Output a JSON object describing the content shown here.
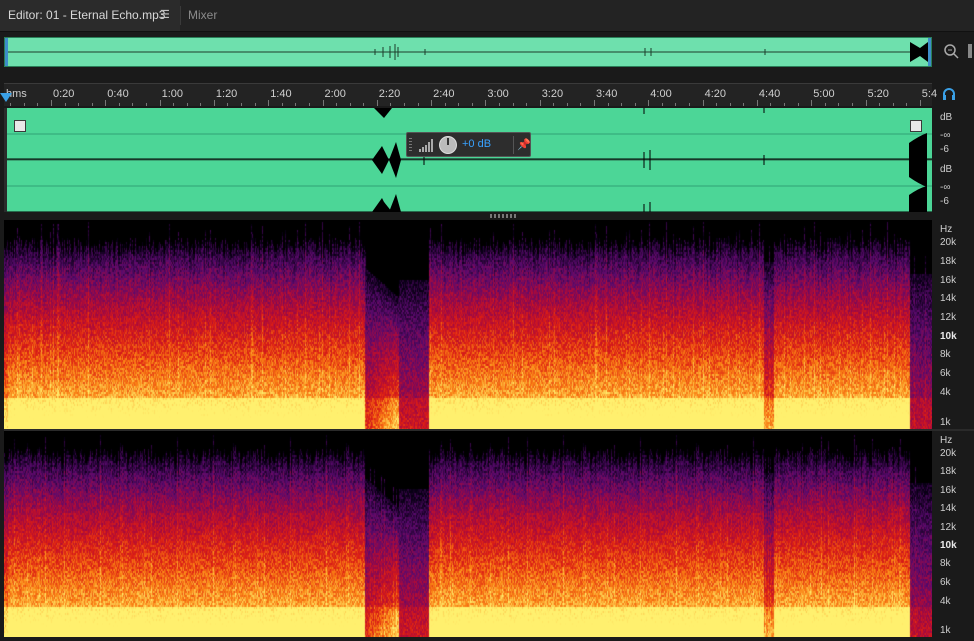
{
  "tabs": {
    "editor_label": "Editor: 01 - Eternal Echo.mp3",
    "menu_glyph": "☰",
    "mixer_label": "Mixer"
  },
  "icons": {
    "zoom": "zoom-icon",
    "headphones": "headphones-icon",
    "pin": "pin-icon"
  },
  "ruler": {
    "unit": "hms",
    "labels": [
      "0:20",
      "0:40",
      "1:00",
      "1:20",
      "1:40",
      "2:00",
      "2:20",
      "2:40",
      "3:00",
      "3:20",
      "3:40",
      "4:00",
      "4:20",
      "4:40",
      "5:00",
      "5:20",
      "5:4"
    ]
  },
  "hud": {
    "value": "+0 dB"
  },
  "db_scale": {
    "ch1": [
      "dB",
      "-∞",
      "-6"
    ],
    "ch2": [
      "dB",
      "-∞",
      "-6"
    ]
  },
  "hz_scale": {
    "unit": "Hz",
    "labels": [
      "20k",
      "18k",
      "16k",
      "14k",
      "12k",
      "10k",
      "8k",
      "6k",
      "4k",
      "1k"
    ]
  },
  "colors": {
    "waveform": "#4cd697",
    "accent": "#3aa0e6"
  }
}
